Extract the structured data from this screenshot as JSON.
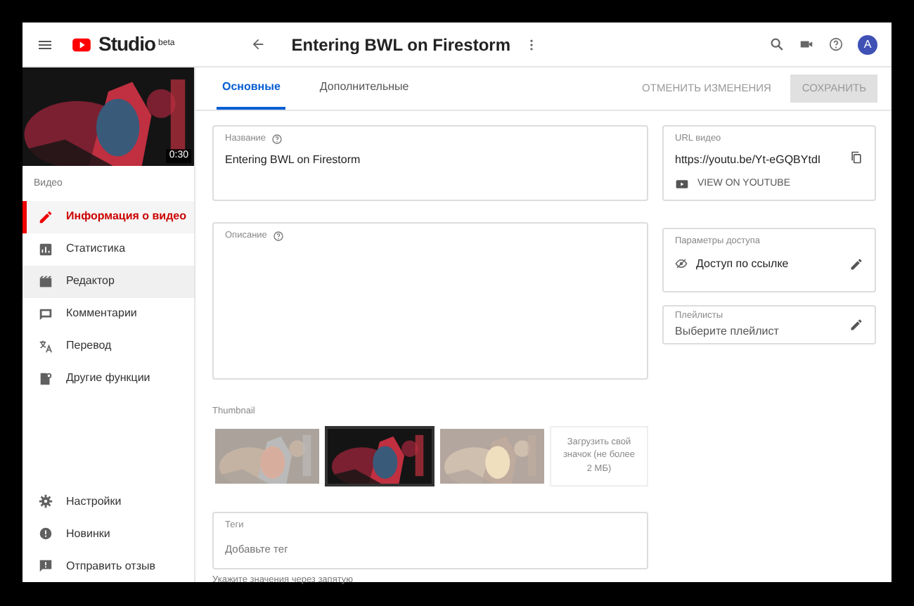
{
  "header": {
    "logo_text": "Studio",
    "logo_badge": "beta",
    "video_title": "Entering BWL on Firestorm",
    "avatar": "A"
  },
  "sidebar": {
    "video_preview": {
      "kind": "picture",
      "duration": "0:30"
    },
    "section_label": "Видео",
    "items": [
      {
        "label": "Информация о видео",
        "selected": true,
        "highlighted": false
      },
      {
        "label": "Статистика",
        "selected": false,
        "highlighted": false
      },
      {
        "label": "Редактор",
        "selected": false,
        "highlighted": true
      },
      {
        "label": "Комментарии",
        "selected": false,
        "highlighted": false
      },
      {
        "label": "Перевод",
        "selected": false,
        "highlighted": false
      },
      {
        "label": "Другие функции",
        "selected": false,
        "highlighted": false
      }
    ],
    "bottom_items": [
      {
        "label": "Настройки"
      },
      {
        "label": "Новинки"
      },
      {
        "label": "Отправить отзыв"
      }
    ]
  },
  "tabs": [
    {
      "label": "Основные",
      "selected": true
    },
    {
      "label": "Дополнительные",
      "selected": false
    }
  ],
  "actions": {
    "discard": "ОТМЕНИТЬ ИЗМЕНЕНИЯ",
    "save": "СОХРАНИТЬ",
    "save_disabled": true
  },
  "title_field": {
    "label": "Название",
    "value": "Entering BWL on Firestorm"
  },
  "description_field": {
    "label": "Описание"
  },
  "thumbnail": {
    "label": "Thumbnail",
    "options": [
      {
        "kind": "picture",
        "selected": false
      },
      {
        "kind": "picture",
        "selected": true
      },
      {
        "kind": "picture",
        "selected": false
      }
    ],
    "upload": "Загрузить свой значок (не более 2 МБ)"
  },
  "tags_field": {
    "label": "Теги",
    "placeholder": "Добавьте тег",
    "hint": "Укажите значения через запятую"
  },
  "url_card": {
    "label": "URL видео",
    "value": "https://youtu.be/Yt-eGQBYtdI",
    "link": "VIEW ON YOUTUBE"
  },
  "access_card": {
    "label": "Параметры доступа",
    "value": "Доступ по ссылке"
  },
  "playlist_card": {
    "label": "Плейлисты",
    "value": "Выберите плейлист"
  }
}
